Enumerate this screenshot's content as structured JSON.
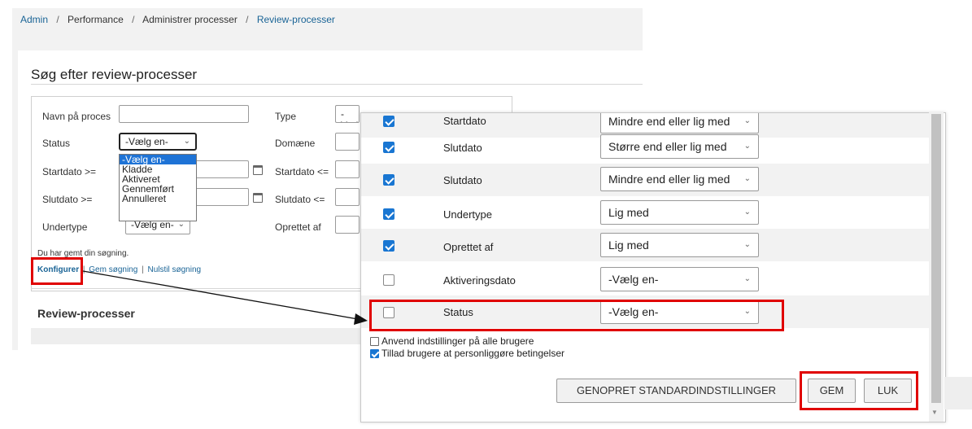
{
  "breadcrumb": {
    "items": [
      "Admin",
      "Performance",
      "Administrer processer",
      "Review-processer"
    ],
    "separator": "/"
  },
  "search_panel": {
    "title": "Søg efter review-processer",
    "fields": {
      "name_label": "Navn på proces",
      "type_label": "Type",
      "type_value": "-Vælg en-",
      "status_label": "Status",
      "status_value": "-Vælg en-",
      "domain_label": "Domæne",
      "startdate_from_label": "Startdato >=",
      "startdate_to_label": "Startdato <=",
      "enddate_from_label": "Slutdato >=",
      "enddate_to_label": "Slutdato <=",
      "subtype_label": "Undertype",
      "subtype_value": "-Vælg en-",
      "created_by_label": "Oprettet af"
    },
    "status_options": [
      "-Vælg en-",
      "Kladde",
      "Aktiveret",
      "Gennemført",
      "Annulleret"
    ],
    "saved_message": "Du har gemt din søgning.",
    "links": {
      "configure": "Konfigurer",
      "save_search": "Gem søgning",
      "reset_search": "Nulstil søgning",
      "separator": "|"
    },
    "results_title": "Review-processer"
  },
  "config_dialog": {
    "rows": [
      {
        "label": "Startdato",
        "operator": "Mindre end eller lig med",
        "checked": true
      },
      {
        "label": "Slutdato",
        "operator": "Større end eller lig med",
        "checked": true
      },
      {
        "label": "Slutdato",
        "operator": "Mindre end eller lig med",
        "checked": true
      },
      {
        "label": "Undertype",
        "operator": "Lig med",
        "checked": true
      },
      {
        "label": "Oprettet af",
        "operator": "Lig med",
        "checked": true
      },
      {
        "label": "Aktiveringsdato",
        "operator": "-Vælg en-",
        "checked": false
      },
      {
        "label": "Status",
        "operator": "-Vælg en-",
        "checked": false
      }
    ],
    "apply_all_label": "Anvend indstillinger på alle brugere",
    "allow_personalize_label": "Tillad brugere at personliggøre betingelser",
    "buttons": {
      "restore_defaults": "GENOPRET STANDARDINDSTILLINGER",
      "save": "GEM",
      "close": "LUK"
    }
  },
  "colors": {
    "link": "#1a6496",
    "highlight": "#e00000",
    "checkbox_checked": "#1976d2",
    "dropdown_selected": "#1e73d6"
  }
}
